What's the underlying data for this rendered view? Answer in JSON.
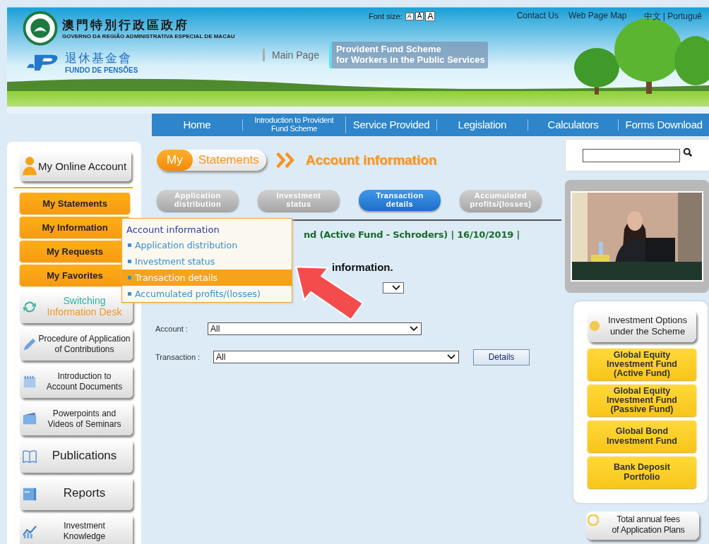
{
  "header": {
    "government_name": "澳門特別行政區政府",
    "government_subtitle": "GOVERNO DA REGIÃO ADMINISTRATIVA ESPECIAL DE MACAU",
    "fund_name": "退休基金會",
    "fund_subtitle": "FUNDO DE PENSÕES",
    "main_page_link": "Main Page",
    "scheme_title": [
      "Provident Fund Scheme",
      "for Workers in the Public Services"
    ],
    "font_size_label": "Font size:",
    "font_size_buttons": [
      "A",
      "A",
      "A"
    ],
    "top_links": [
      "Contact Us",
      "Web Page Map"
    ],
    "language_links": "中文 | Portuguê"
  },
  "nav": [
    {
      "label": "Home"
    },
    {
      "label": "Introduction to Provident Fund Scheme"
    },
    {
      "label": "Service Provided"
    },
    {
      "label": "Legislation"
    },
    {
      "label": "Calculators"
    },
    {
      "label": "Forms Download"
    }
  ],
  "sidebar": {
    "account_button": "My Online Account",
    "submenu": [
      "My Statements",
      "My Information",
      "My Requests",
      "My Favorites"
    ],
    "feature_buttons": [
      {
        "kind": "switch",
        "lines": [
          "Switching",
          "Information Desk"
        ]
      },
      {
        "kind": "procedure",
        "lines": [
          "Procedure of Application",
          "of Contributions"
        ]
      },
      {
        "kind": "documents",
        "lines": [
          "Introduction to",
          "Account Documents"
        ]
      },
      {
        "kind": "seminars",
        "lines": [
          "Powerpoints and",
          "Videos of Seminars"
        ]
      },
      {
        "kind": "book",
        "lines": [
          "Publications"
        ]
      },
      {
        "kind": "reports",
        "lines": [
          "Reports"
        ]
      },
      {
        "kind": "chart",
        "lines": [
          "Investment",
          "Knowledge"
        ]
      }
    ]
  },
  "main": {
    "breadcrumb": {
      "my": "My",
      "section": "Statements",
      "page_title": "Account information"
    },
    "tabs": [
      {
        "lines": [
          "Application",
          "distribution"
        ],
        "selected": false
      },
      {
        "lines": [
          "Investment",
          "status"
        ],
        "selected": false
      },
      {
        "lines": [
          "Transaction",
          "details"
        ],
        "selected": true
      },
      {
        "lines": [
          "Accumulated",
          "profits/(losses)"
        ],
        "selected": false
      }
    ],
    "fund_line": "nd (Active Fund - Schroders) | 16/10/2019 |",
    "instruction": "information.",
    "menu": {
      "heading": "Account information",
      "items": [
        {
          "label": "Application distribution",
          "selected": false
        },
        {
          "label": "Investment status",
          "selected": false
        },
        {
          "label": "Transaction details",
          "selected": true
        },
        {
          "label": "Accumulated profits/(losses)",
          "selected": false
        }
      ]
    },
    "fields": [
      {
        "label": "Account :",
        "value": "All"
      },
      {
        "label": "Transaction :",
        "value": "All"
      }
    ],
    "details_button": "Details"
  },
  "right": {
    "options_button": [
      "Investment Options",
      "under the Scheme"
    ],
    "fund_buttons": [
      [
        "Global Equity",
        "Investment Fund",
        "(Active Fund)"
      ],
      [
        "Global Equity",
        "Investment Fund",
        "(Passive Fund)"
      ],
      [
        "Global Bond",
        "Investment Fund"
      ],
      [
        "Bank Deposit",
        "Portfolio"
      ]
    ],
    "fees_button": [
      "Total annual fees",
      "of Application Plans"
    ]
  }
}
